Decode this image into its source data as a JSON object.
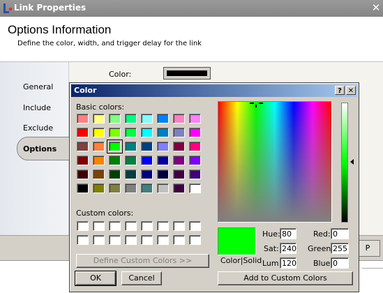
{
  "window": {
    "title": "Link Properties",
    "close_glyph": "✕",
    "header_title": "Options Information",
    "header_subtitle": "Define the color, width, and trigger delay for the link",
    "nav": [
      "General",
      "Include",
      "Exclude",
      "Options"
    ],
    "selected_nav": "Options",
    "color_label": "Color:",
    "color_value": "#000000",
    "partial_button": "P"
  },
  "dialog": {
    "title": "Color",
    "help_glyph": "?",
    "close_glyph": "✕",
    "basic_colors_label": "Basic colors:",
    "custom_colors_label": "Custom colors:",
    "basic_colors": [
      [
        "#ff8080",
        "#ffff80",
        "#80ff80",
        "#00ff80",
        "#80ffff",
        "#0080ff",
        "#ff80c0",
        "#ff80ff"
      ],
      [
        "#ff0000",
        "#ffff00",
        "#80ff00",
        "#00ff40",
        "#00ffff",
        "#0080c0",
        "#8080c0",
        "#ff00ff"
      ],
      [
        "#804040",
        "#ff8040",
        "#00ff00",
        "#008080",
        "#004080",
        "#8080ff",
        "#800040",
        "#ff0080"
      ],
      [
        "#800000",
        "#ff8000",
        "#008000",
        "#008040",
        "#0000ff",
        "#0000a0",
        "#800080",
        "#8000ff"
      ],
      [
        "#400000",
        "#804000",
        "#004000",
        "#004040",
        "#000080",
        "#000040",
        "#400040",
        "#400080"
      ],
      [
        "#000000",
        "#808000",
        "#808040",
        "#808080",
        "#408080",
        "#c0c0c0",
        "#400040",
        "#ffffff"
      ]
    ],
    "selected_swatch": "#00ff00",
    "custom_colors": [
      "#ffffff",
      "#ffffff",
      "#ffffff",
      "#ffffff",
      "#ffffff",
      "#ffffff",
      "#ffffff",
      "#ffffff",
      "#ffffff",
      "#ffffff",
      "#ffffff",
      "#ffffff",
      "#ffffff",
      "#ffffff",
      "#ffffff",
      "#ffffff"
    ],
    "define_custom_button": "Define Custom Colors >>",
    "ok_button": "OK",
    "cancel_button": "Cancel",
    "add_custom_button": "Add to Custom Colors",
    "color_solid_label": "Color|Solid",
    "preview_color": "#00ff00",
    "hue_label": "Hue:",
    "hue_value": "80",
    "sat_label": "Sat:",
    "sat_value": "240",
    "lum_label": "Lum:",
    "lum_value": "120",
    "red_label": "Red:",
    "red_value": "0",
    "green_label": "Green:",
    "green_value": "255",
    "blue_label": "Blue:",
    "blue_value": "0"
  }
}
